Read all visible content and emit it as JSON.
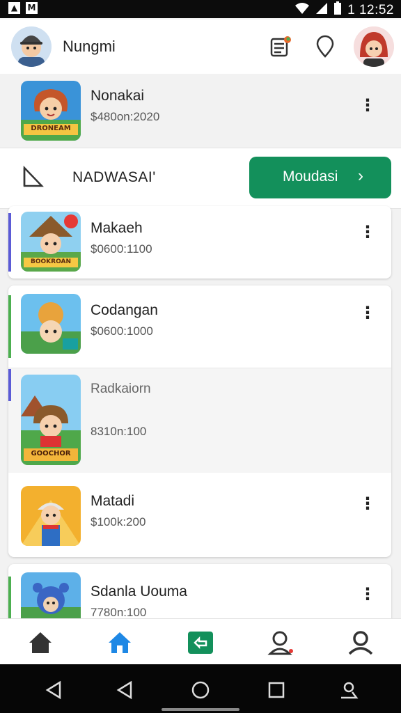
{
  "status_bar": {
    "time": "1 12:52"
  },
  "header": {
    "title": "Nungmi"
  },
  "items": [
    {
      "title": "Nonakai",
      "subtitle": "$480on:2020",
      "badge": "DRONEAM"
    },
    {
      "title": "Makaeh",
      "subtitle": "$0600:1100",
      "badge": "BOOKROAN"
    },
    {
      "title": "Codangan",
      "subtitle": "$0600:1000"
    },
    {
      "title": "Radkaiorn",
      "subtitle": "8310n:100",
      "badge": "GOOCHOR"
    },
    {
      "title": "Matadi",
      "subtitle": "$100k:200"
    },
    {
      "title": "Sdanla Uouma",
      "subtitle": "7780n:100"
    }
  ],
  "banner": {
    "label": "NADWASAI'",
    "button_label": "Moudasi"
  },
  "colors": {
    "accent_green": "#13905b",
    "nav_active": "#1e88e5",
    "accent_purple": "#5b5bd6",
    "accent_lightgreen": "#4caf50"
  },
  "nav": [
    "home-icon",
    "home-active-icon",
    "ticket-icon",
    "person-pin-icon",
    "profile-icon"
  ]
}
